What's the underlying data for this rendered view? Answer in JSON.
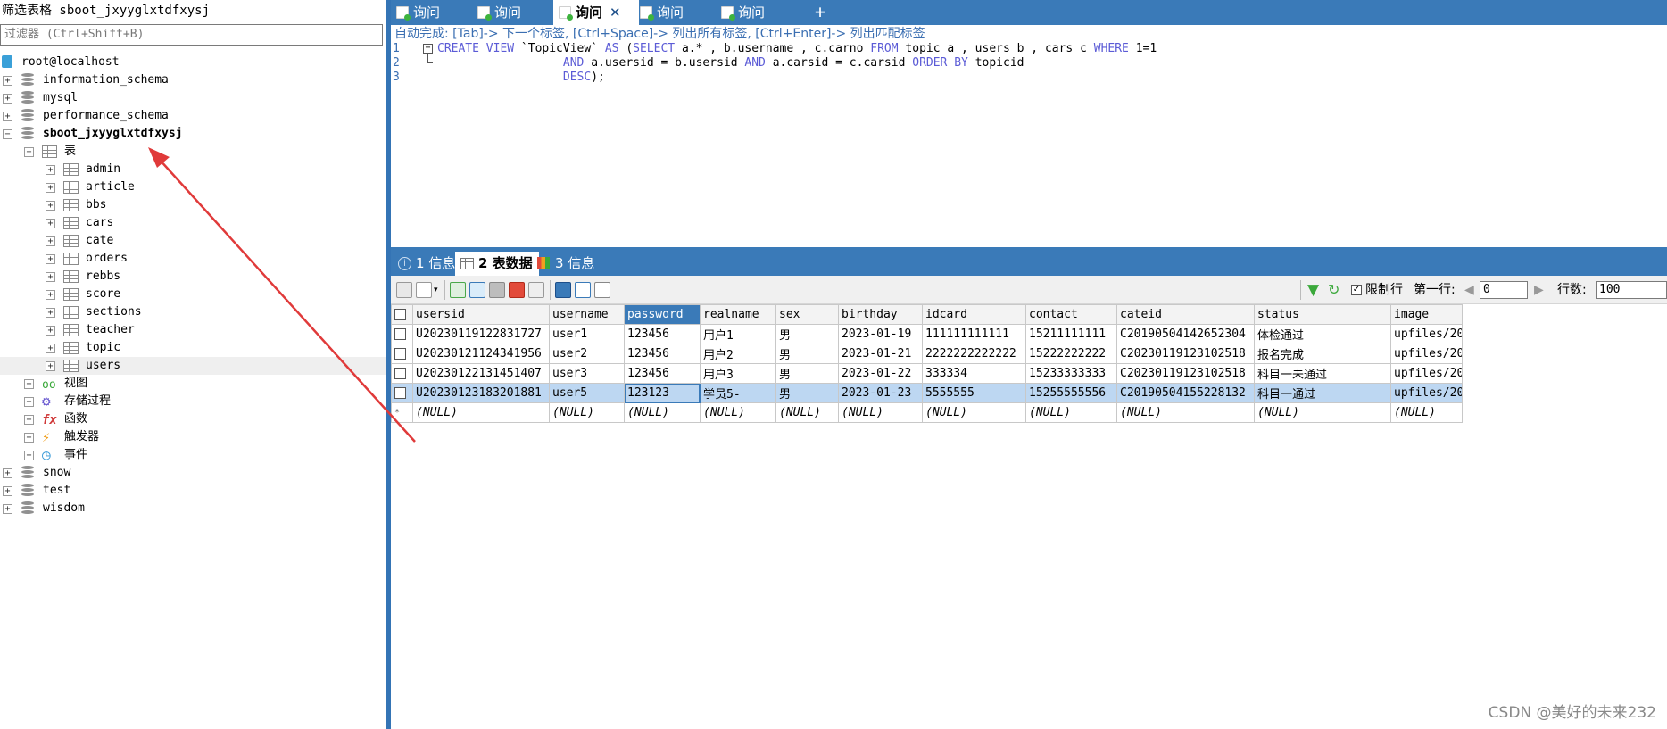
{
  "left_panel": {
    "title": "筛选表格 sboot_jxyyglxtdfxysj",
    "filter_placeholder": "过滤器 (Ctrl+Shift+B)",
    "root": "root@localhost",
    "databases_top": [
      "information_schema",
      "mysql",
      "performance_schema"
    ],
    "active_db": "sboot_jxyyglxtdfxysj",
    "tables_folder": "表",
    "tables": [
      "admin",
      "article",
      "bbs",
      "cars",
      "cate",
      "orders",
      "rebbs",
      "score",
      "sections",
      "teacher",
      "topic",
      "users"
    ],
    "folders": [
      "视图",
      "存储过程",
      "函数",
      "触发器",
      "事件"
    ],
    "databases_bottom": [
      "snow",
      "test",
      "wisdom"
    ]
  },
  "tabs": [
    {
      "label": "询问",
      "active": false
    },
    {
      "label": "询问",
      "active": false
    },
    {
      "label": "询问",
      "active": true
    },
    {
      "label": "询问",
      "active": false
    },
    {
      "label": "询问",
      "active": false
    }
  ],
  "tab_close": "✕",
  "tab_add": "+",
  "autocomplete_hint": "自动完成: [Tab]-> 下一个标签, [Ctrl+Space]-> 列出所有标签, [Ctrl+Enter]-> 列出匹配标签",
  "editor": {
    "line_numbers": [
      "1",
      "2",
      "3"
    ],
    "lines": [
      "CREATE VIEW `TopicView` AS (SELECT a.* , b.username , c.carno FROM topic a , users b , cars c WHERE 1=1",
      "                  AND a.usersid = b.usersid AND a.carsid = c.carsid ORDER BY topicid",
      "                  DESC);"
    ]
  },
  "result_tabs": [
    {
      "num": "1",
      "label": "信息",
      "active": false
    },
    {
      "num": "2",
      "label": "表数据",
      "active": true
    },
    {
      "num": "3",
      "label": "信息",
      "active": false
    }
  ],
  "toolbar": {
    "limit_label": "限制行",
    "first_row_label": "第一行:",
    "first_row_value": "0",
    "rows_label": "行数:",
    "rows_value": "100"
  },
  "grid": {
    "columns": [
      "usersid",
      "username",
      "password",
      "realname",
      "sex",
      "birthday",
      "idcard",
      "contact",
      "cateid",
      "status",
      "image"
    ],
    "rows": [
      [
        "U20230119122831727",
        "user1",
        "123456",
        "用户1",
        "男",
        "2023-01-19",
        "111111111111",
        "15211111111",
        "C20190504142652304",
        "体检通过",
        "upfiles/202"
      ],
      [
        "U20230121124341956",
        "user2",
        "123456",
        "用户2",
        "男",
        "2023-01-21",
        "2222222222222",
        "15222222222",
        "C20230119123102518",
        "报名完成",
        "upfiles/202"
      ],
      [
        "U20230122131451407",
        "user3",
        "123456",
        "用户3",
        "男",
        "2023-01-22",
        "333334",
        "15233333333",
        "C20230119123102518",
        "科目一未通过",
        "upfiles/202"
      ],
      [
        "U20230123183201881",
        "user5",
        "123123",
        "学员5-",
        "男",
        "2023-01-23",
        "5555555",
        "15255555556",
        "C20190504155228132",
        "科目一通过",
        "upfiles/202"
      ]
    ],
    "null_label": "(NULL)",
    "new_row_marker": "*"
  },
  "watermark": "CSDN @美好的未来232",
  "colors": {
    "accent": "#3a7ab8",
    "keyword": "#5b5bd6",
    "arrow": "#e03a3a"
  }
}
